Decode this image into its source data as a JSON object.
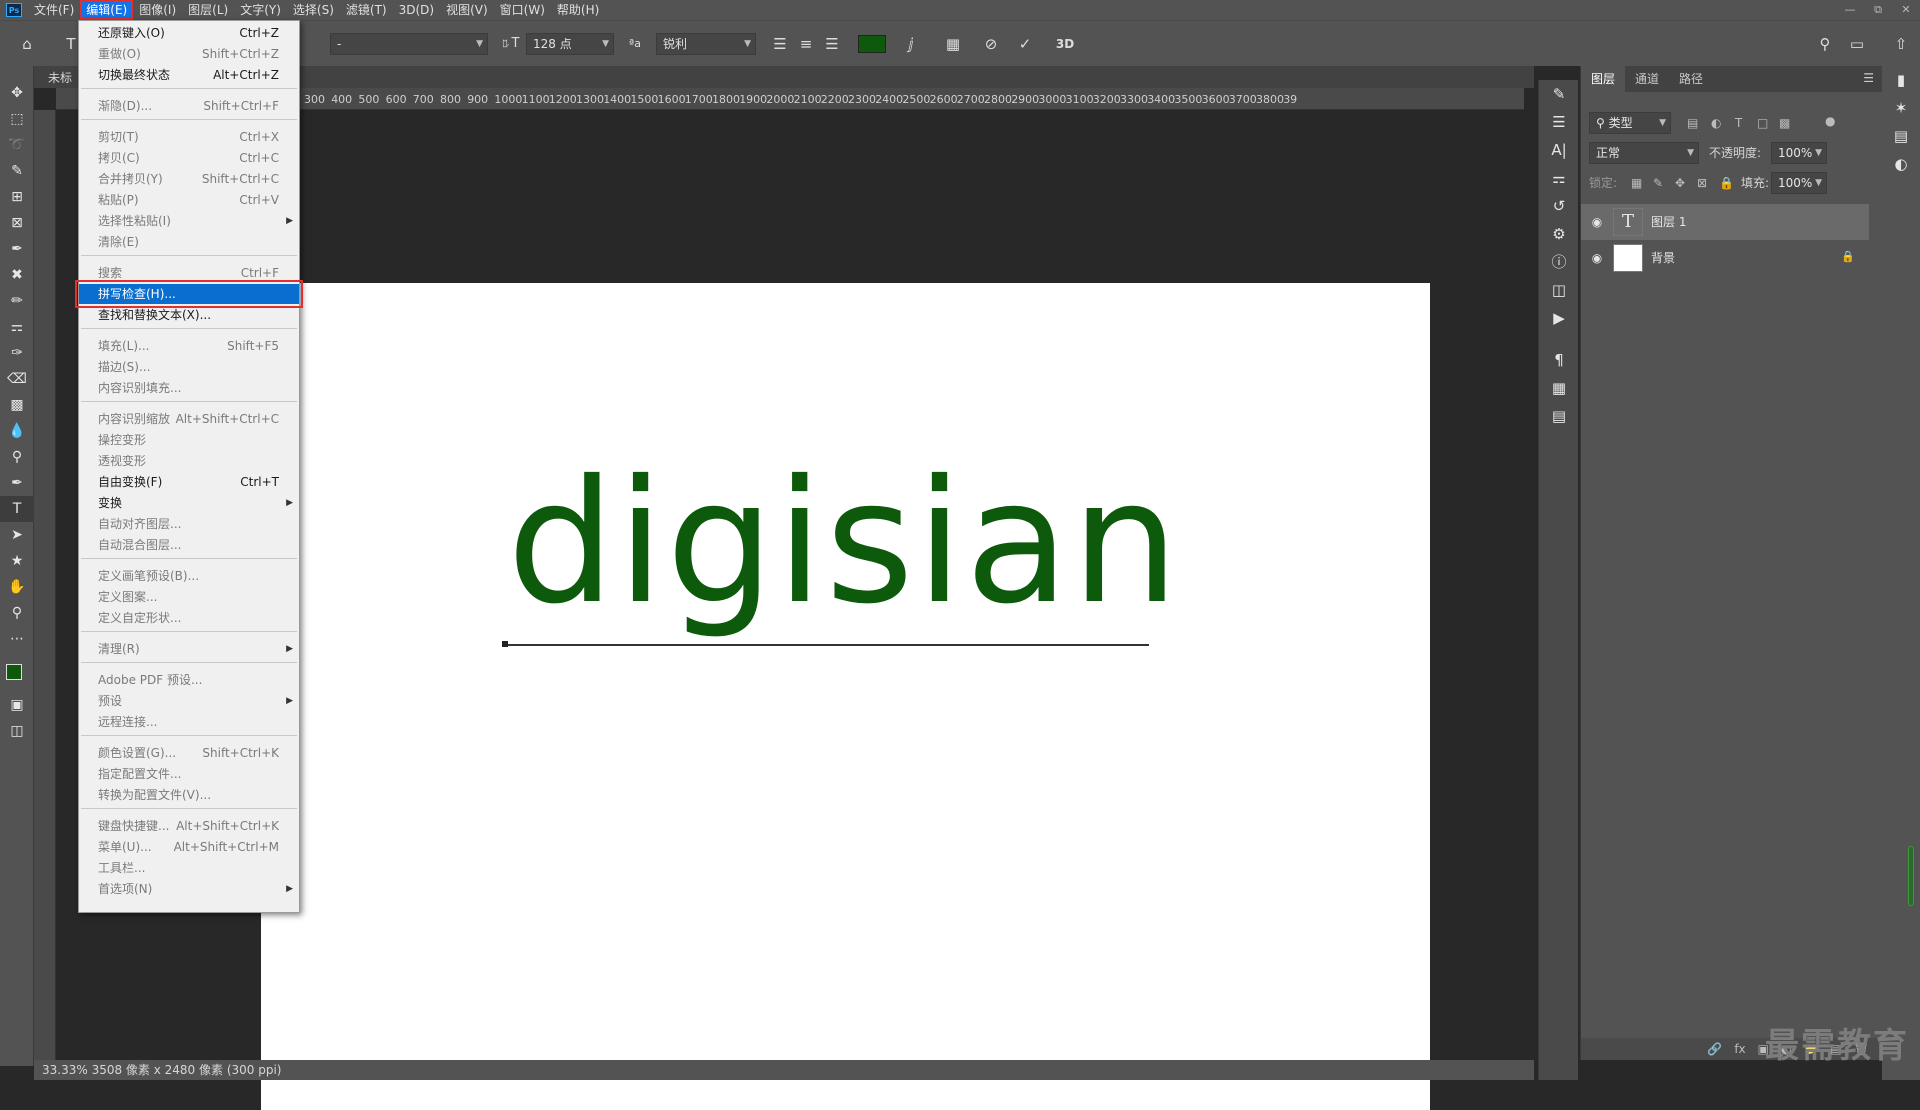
{
  "menubar": {
    "logo": "Ps",
    "items": [
      "文件(F)",
      "编辑(E)",
      "图像(I)",
      "图层(L)",
      "文字(Y)",
      "选择(S)",
      "滤镜(T)",
      "3D(D)",
      "视图(V)",
      "窗口(W)",
      "帮助(H)"
    ],
    "active_index": 1
  },
  "optionsbar": {
    "font_style": "-",
    "font_size": "128 点",
    "antialias_label": "ªa",
    "antialias": "锐利",
    "three_d": "3D",
    "text_color": "#0d5a0d"
  },
  "document": {
    "tab_label": "未标",
    "canvas_text": "digisian",
    "text_color": "#0d5a0d",
    "ruler_labels": [
      "300",
      "400",
      "500",
      "600",
      "700",
      "800",
      "900",
      "1000",
      "1100",
      "1200",
      "1300",
      "1400",
      "1500",
      "1600",
      "1700",
      "1800",
      "1900",
      "2000",
      "2100",
      "2200",
      "2300",
      "2400",
      "2500",
      "2600",
      "2700",
      "2800",
      "2900",
      "3000",
      "3100",
      "3200",
      "3300",
      "3400",
      "3500",
      "3600",
      "3700",
      "3800",
      "39"
    ]
  },
  "statusbar": {
    "text": "33.33%  3508 像素 x 2480 像素 (300 ppi)"
  },
  "edit_menu": {
    "groups": [
      [
        {
          "label": "还原键入(O)",
          "shortcut": "Ctrl+Z",
          "enabled": true
        },
        {
          "label": "重做(O)",
          "shortcut": "Shift+Ctrl+Z",
          "enabled": false
        },
        {
          "label": "切换最终状态",
          "shortcut": "Alt+Ctrl+Z",
          "enabled": true
        }
      ],
      [
        {
          "label": "渐隐(D)...",
          "shortcut": "Shift+Ctrl+F",
          "enabled": false
        }
      ],
      [
        {
          "label": "剪切(T)",
          "shortcut": "Ctrl+X",
          "enabled": false
        },
        {
          "label": "拷贝(C)",
          "shortcut": "Ctrl+C",
          "enabled": false
        },
        {
          "label": "合并拷贝(Y)",
          "shortcut": "Shift+Ctrl+C",
          "enabled": false
        },
        {
          "label": "粘贴(P)",
          "shortcut": "Ctrl+V",
          "enabled": false
        },
        {
          "label": "选择性粘贴(I)",
          "shortcut": "",
          "enabled": false,
          "submenu": true
        },
        {
          "label": "清除(E)",
          "shortcut": "",
          "enabled": false
        }
      ],
      [
        {
          "label": "搜索",
          "shortcut": "Ctrl+F",
          "enabled": false
        },
        {
          "label": "拼写检查(H)...",
          "shortcut": "",
          "enabled": true,
          "highlighted": true
        },
        {
          "label": "查找和替换文本(X)...",
          "shortcut": "",
          "enabled": true
        }
      ],
      [
        {
          "label": "填充(L)...",
          "shortcut": "Shift+F5",
          "enabled": false
        },
        {
          "label": "描边(S)...",
          "shortcut": "",
          "enabled": false
        },
        {
          "label": "内容识别填充...",
          "shortcut": "",
          "enabled": false
        }
      ],
      [
        {
          "label": "内容识别缩放",
          "shortcut": "Alt+Shift+Ctrl+C",
          "enabled": false
        },
        {
          "label": "操控变形",
          "shortcut": "",
          "enabled": false
        },
        {
          "label": "透视变形",
          "shortcut": "",
          "enabled": false
        },
        {
          "label": "自由变换(F)",
          "shortcut": "Ctrl+T",
          "enabled": true
        },
        {
          "label": "变换",
          "shortcut": "",
          "enabled": true,
          "submenu": true
        },
        {
          "label": "自动对齐图层...",
          "shortcut": "",
          "enabled": false
        },
        {
          "label": "自动混合图层...",
          "shortcut": "",
          "enabled": false
        }
      ],
      [
        {
          "label": "定义画笔预设(B)...",
          "shortcut": "",
          "enabled": false
        },
        {
          "label": "定义图案...",
          "shortcut": "",
          "enabled": false
        },
        {
          "label": "定义自定形状...",
          "shortcut": "",
          "enabled": false
        }
      ],
      [
        {
          "label": "清理(R)",
          "shortcut": "",
          "enabled": false,
          "submenu": true
        }
      ],
      [
        {
          "label": "Adobe PDF 预设...",
          "shortcut": "",
          "enabled": false
        },
        {
          "label": "预设",
          "shortcut": "",
          "enabled": false,
          "submenu": true
        },
        {
          "label": "远程连接...",
          "shortcut": "",
          "enabled": false
        }
      ],
      [
        {
          "label": "颜色设置(G)...",
          "shortcut": "Shift+Ctrl+K",
          "enabled": false
        },
        {
          "label": "指定配置文件...",
          "shortcut": "",
          "enabled": false
        },
        {
          "label": "转换为配置文件(V)...",
          "shortcut": "",
          "enabled": false
        }
      ],
      [
        {
          "label": "键盘快捷键...",
          "shortcut": "Alt+Shift+Ctrl+K",
          "enabled": false
        },
        {
          "label": "菜单(U)...",
          "shortcut": "Alt+Shift+Ctrl+M",
          "enabled": false
        },
        {
          "label": "工具栏...",
          "shortcut": "",
          "enabled": false
        },
        {
          "label": "首选项(N)",
          "shortcut": "",
          "enabled": false,
          "submenu": true
        }
      ]
    ]
  },
  "layers_panel": {
    "tabs": [
      "图层",
      "通道",
      "路径"
    ],
    "active_tab": 0,
    "search_placeholder": "类型",
    "blend_mode": "正常",
    "opacity_label": "不透明度:",
    "opacity": "100%",
    "lock_label": "锁定:",
    "fill_label": "填充:",
    "fill": "100%",
    "layers": [
      {
        "name": "图层 1",
        "type": "text",
        "selected": true,
        "locked": false
      },
      {
        "name": "背景",
        "type": "background",
        "selected": false,
        "locked": true
      }
    ]
  },
  "watermark": "最需教育"
}
